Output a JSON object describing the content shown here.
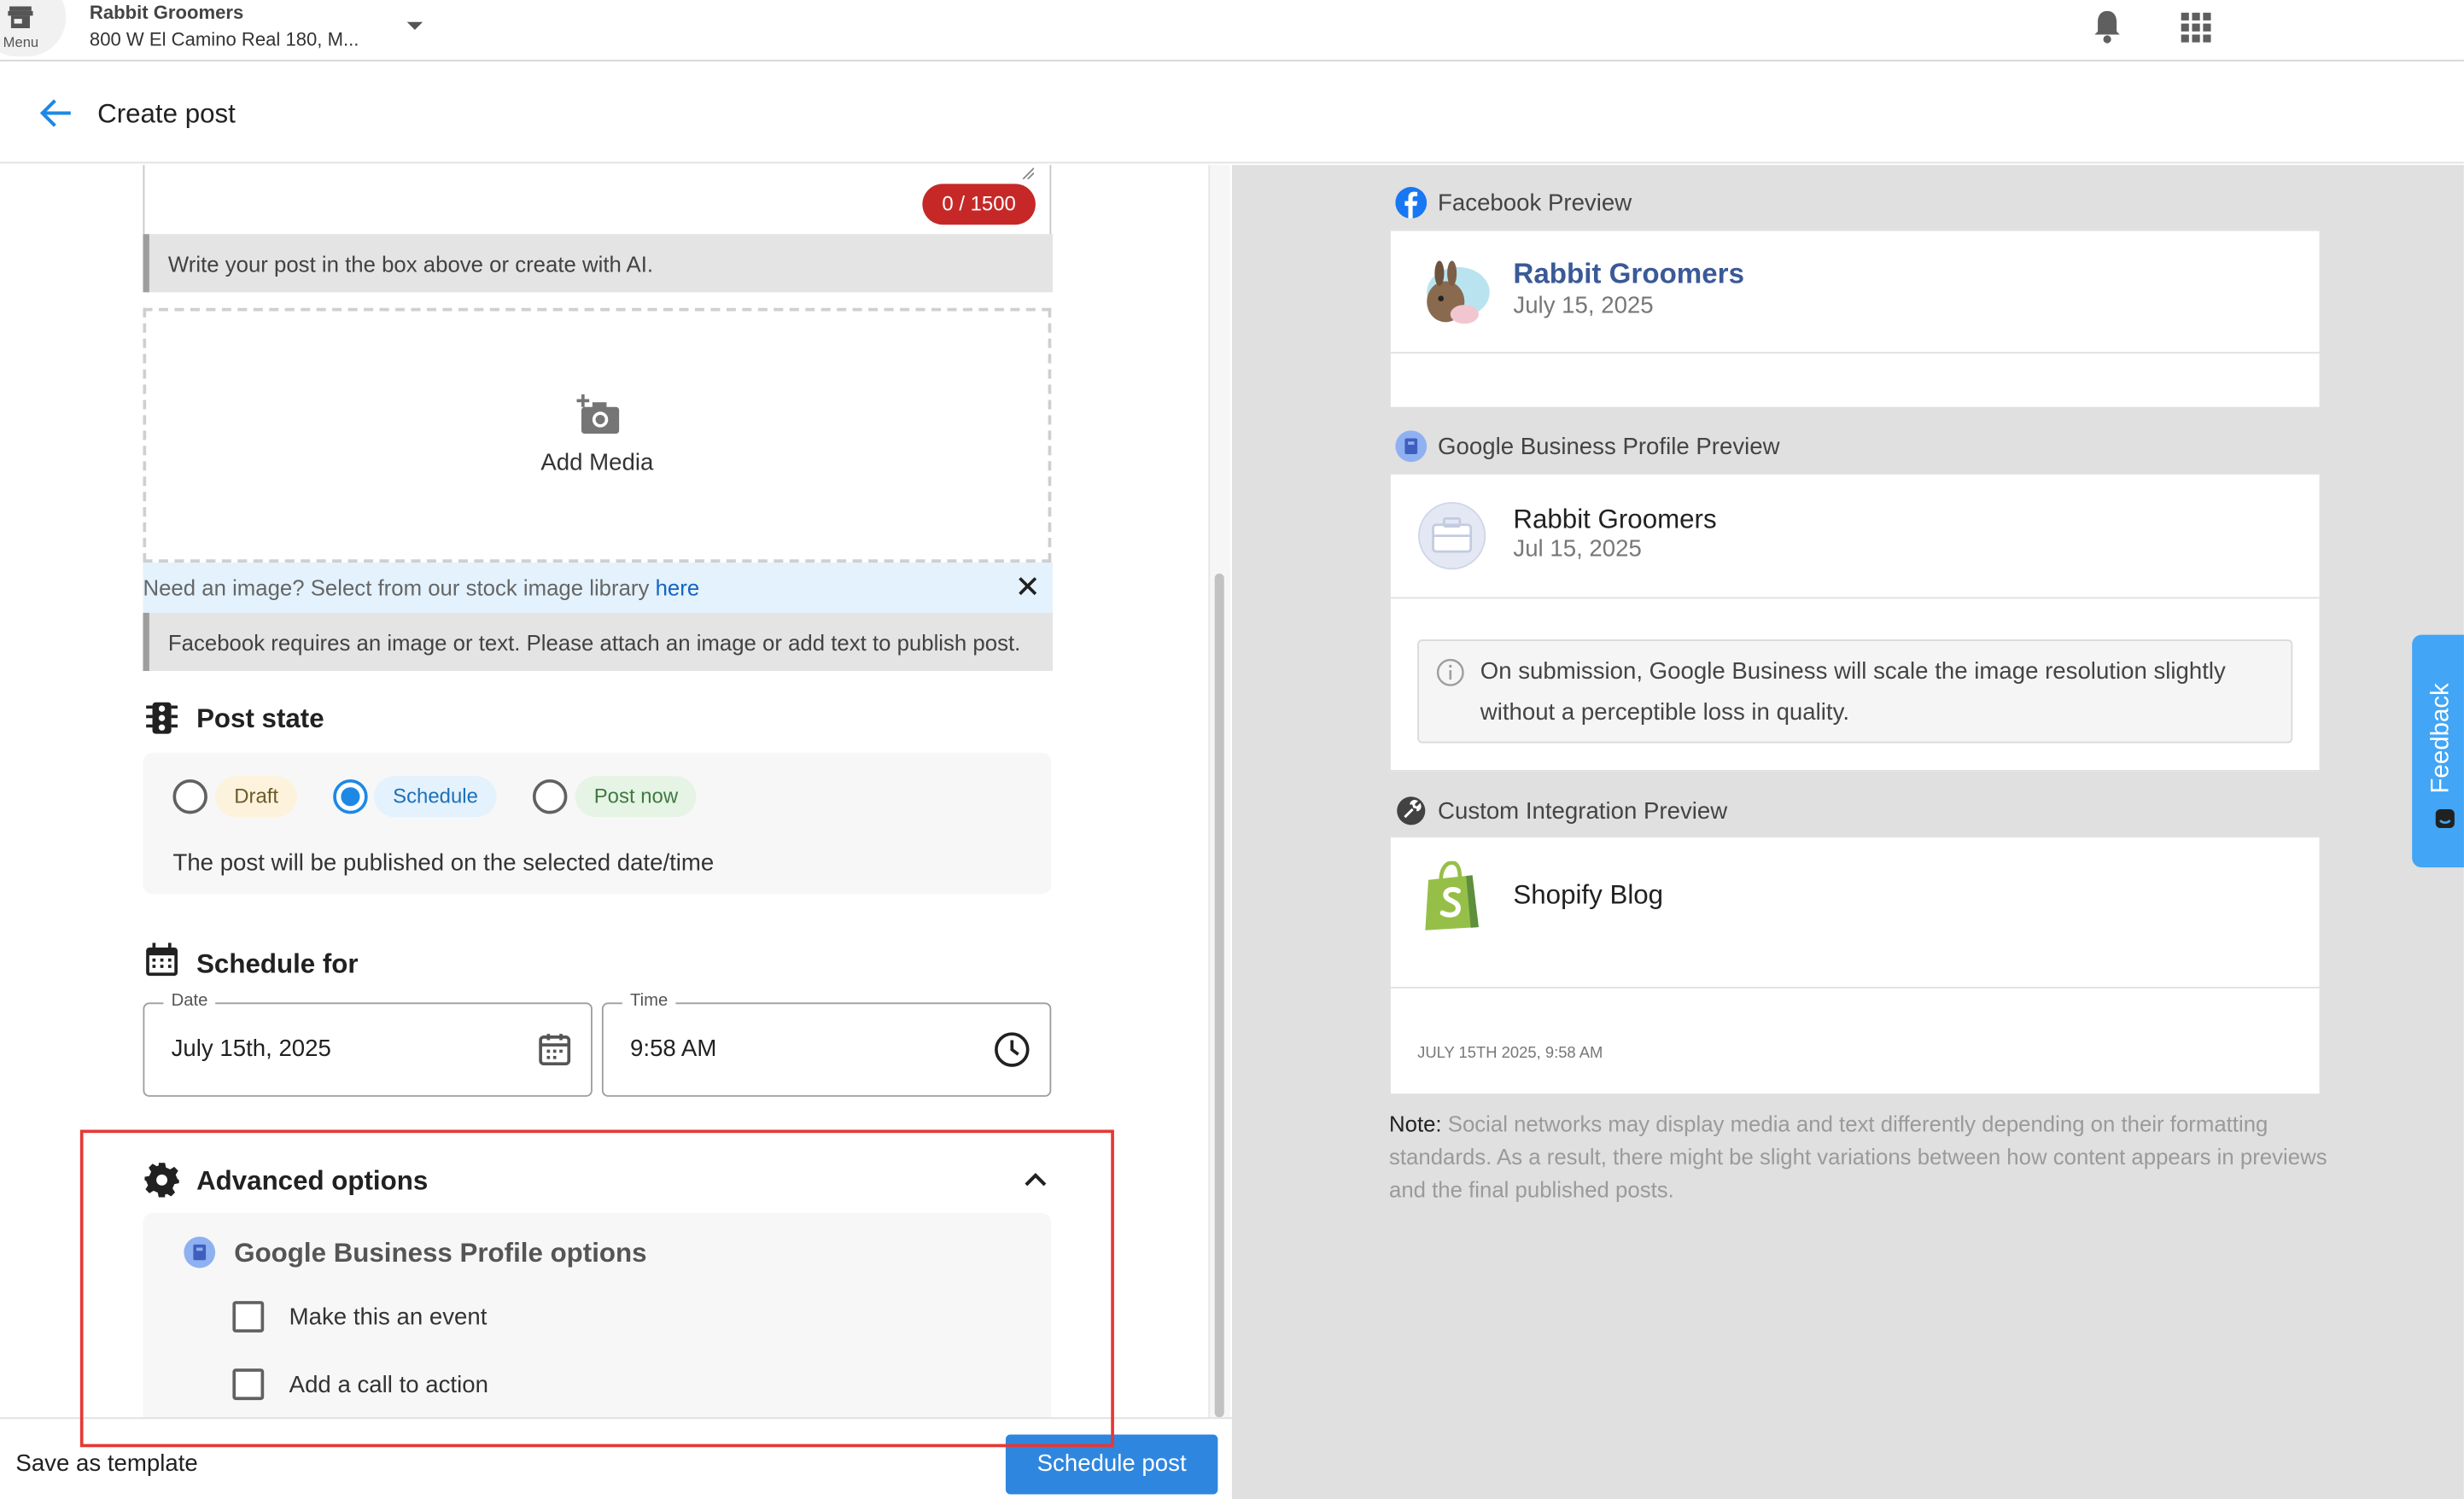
{
  "topbar": {
    "menu_label": "Menu",
    "business_name": "Rabbit Groomers",
    "business_address": "800 W El Camino Real 180, M..."
  },
  "header": {
    "title": "Create post"
  },
  "composer": {
    "char_count": "0 / 1500",
    "hint": "Write your post in the box above or create with AI.",
    "add_media_label": "Add Media",
    "stock_prompt": "Need an image? Select from our stock image library ",
    "stock_link": "here",
    "facebook_warning": "Facebook requires an image or text. Please attach an image or add text to publish post."
  },
  "post_state": {
    "title": "Post state",
    "options": [
      {
        "label": "Draft",
        "selected": false
      },
      {
        "label": "Schedule",
        "selected": true
      },
      {
        "label": "Post now",
        "selected": false
      }
    ],
    "description": "The post will be published on the selected date/time"
  },
  "schedule": {
    "title": "Schedule for",
    "date_label": "Date",
    "date_value": "July 15th, 2025",
    "time_label": "Time",
    "time_value": "9:58 AM"
  },
  "advanced": {
    "title": "Advanced options",
    "gbp_title": "Google Business Profile options",
    "checkboxes": [
      {
        "label": "Make this an event",
        "checked": false
      },
      {
        "label": "Add a call to action",
        "checked": false
      }
    ]
  },
  "footer": {
    "save_template": "Save as template",
    "schedule_button": "Schedule post"
  },
  "previews": {
    "facebook": {
      "heading": "Facebook Preview",
      "name": "Rabbit Groomers",
      "date": "July 15, 2025"
    },
    "google": {
      "heading": "Google Business Profile Preview",
      "name": "Rabbit Groomers",
      "date": "Jul 15, 2025",
      "info": "On submission, Google Business will scale the image resolution slightly without a perceptible loss in quality."
    },
    "custom": {
      "heading": "Custom Integration Preview",
      "name": "Shopify Blog",
      "date": "JULY 15TH 2025, 9:58 AM"
    },
    "note_label": "Note:",
    "note_text": "Social networks may display media and text differently depending on their formatting standards. As a result, there might be slight variations between how content appears in previews and the final published posts."
  },
  "feedback_label": "Feedback",
  "colors": {
    "accent": "#2f86df",
    "danger": "#c62828",
    "facebook": "#1877f2",
    "shopify": "#95bf47",
    "highlight": "#e53935"
  }
}
